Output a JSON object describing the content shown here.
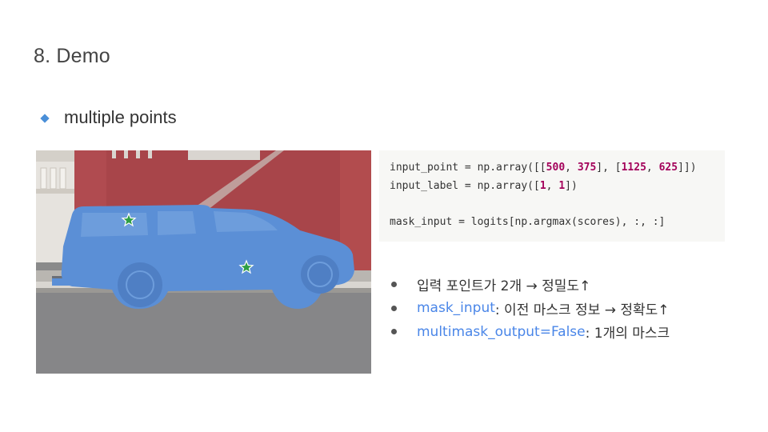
{
  "slide": {
    "title": "8.  Demo",
    "subtitle": "multiple points"
  },
  "code": {
    "line1": {
      "a": "input_point = np.array([[",
      "n1": "500",
      "c1": ", ",
      "n2": "375",
      "c2": "], [",
      "n3": "1125",
      "c3": ", ",
      "n4": "625",
      "c4": "]])"
    },
    "line2": {
      "a": "input_label = np.array([",
      "n1": "1",
      "c1": ", ",
      "n2": "1",
      "c2": "])"
    },
    "line3": "mask_input = logits[np.argmax(scores), :, :]"
  },
  "bullets": [
    {
      "text": "입력 포인트가 2개 → 정밀도↑"
    },
    {
      "code": "mask_input",
      "text": ": 이전 마스크 정보 → 정확도↑"
    },
    {
      "code": "multimask_output=False",
      "text": ": 1개의 마스크"
    }
  ],
  "colors": {
    "accent": "#4a8fd8",
    "code_number": "#a3005a",
    "code_blue": "#4a86e8",
    "mask_blue": "#5b8fd6",
    "star_green": "#2e9e44"
  },
  "icons": {
    "bullet": "diamond-icon",
    "prompt_point": "star-icon"
  }
}
